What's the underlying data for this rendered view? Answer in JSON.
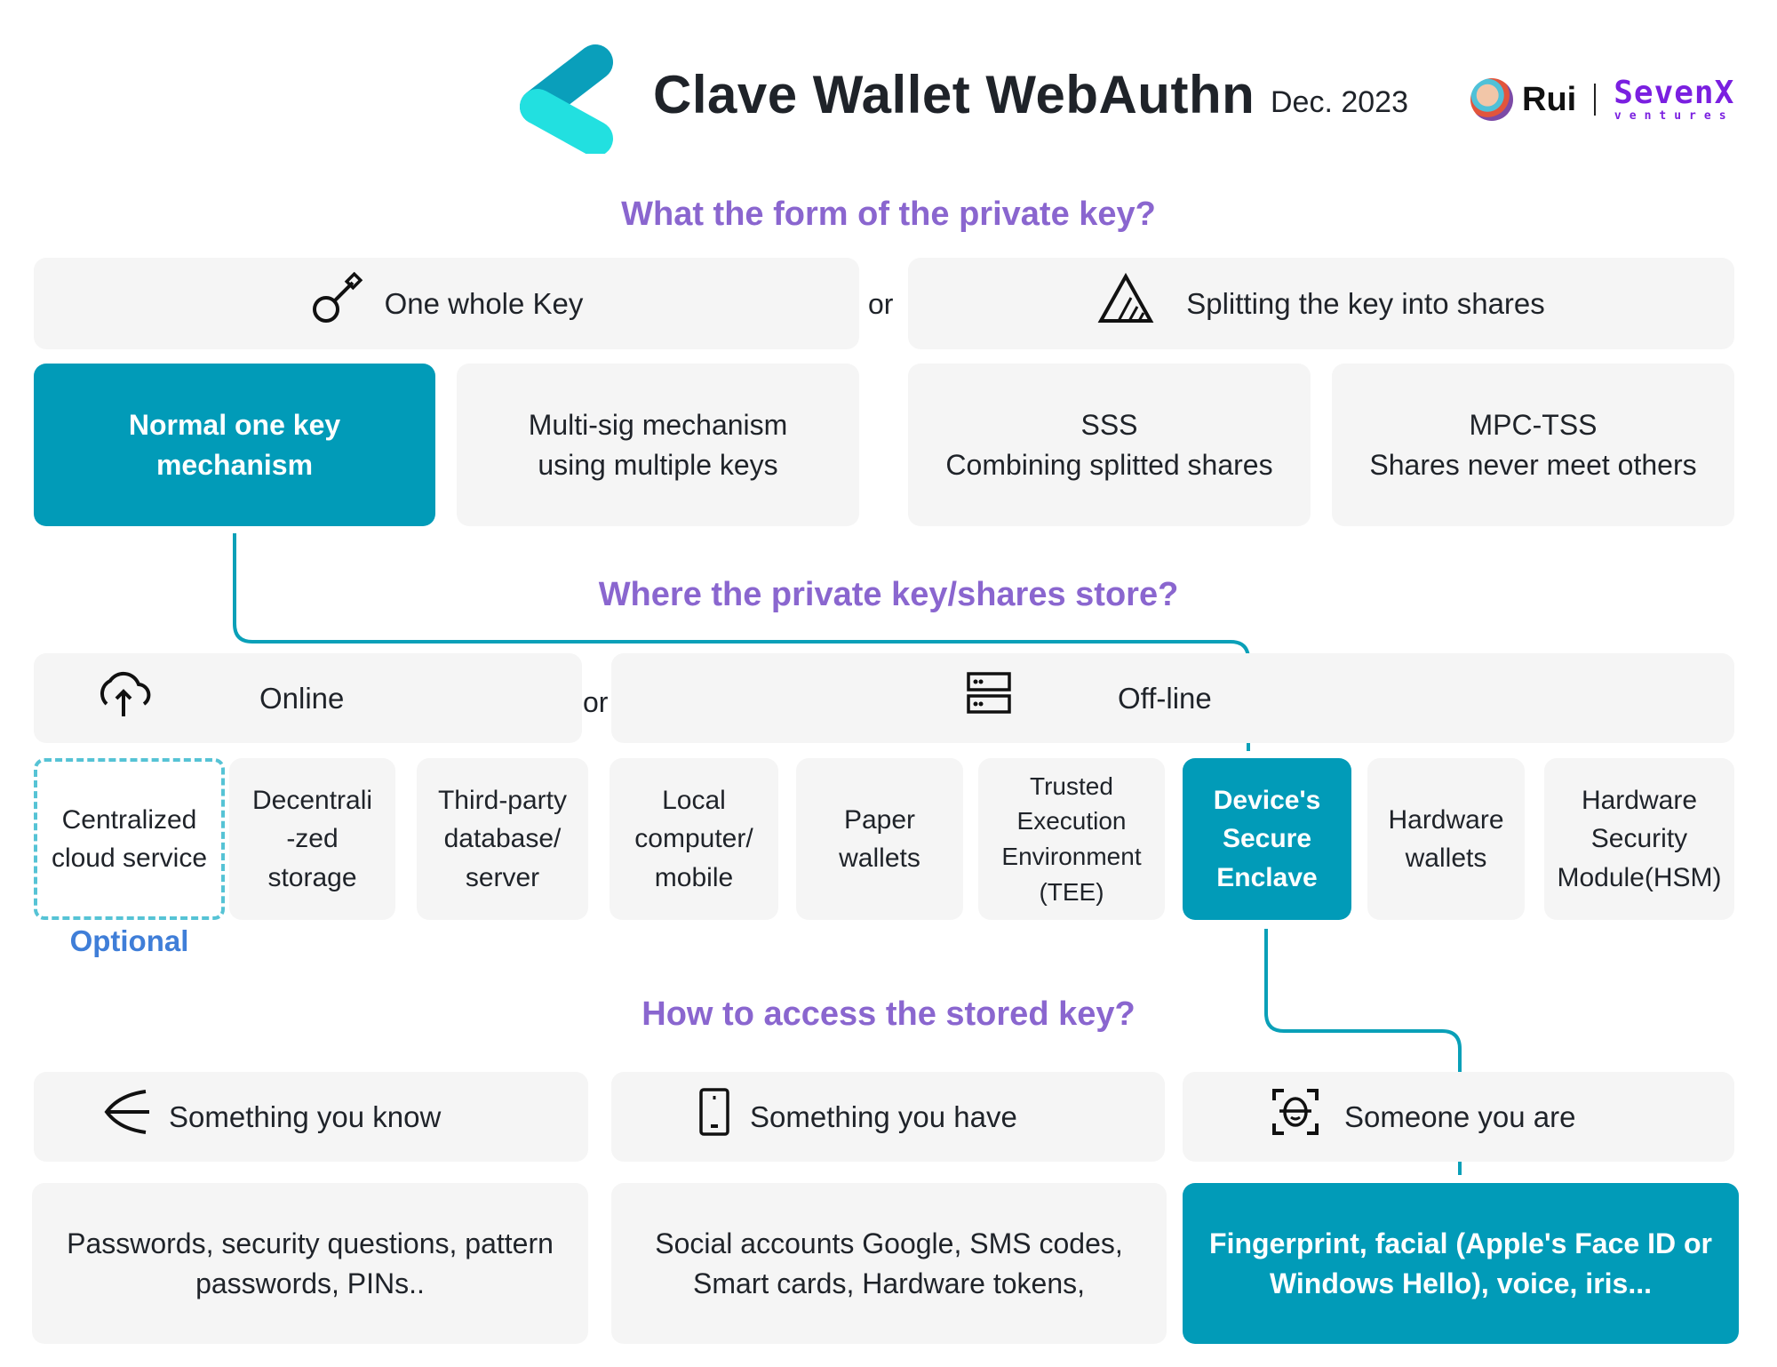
{
  "header": {
    "title": "Clave Wallet WebAuthn",
    "date": "Dec. 2023",
    "author": "Rui",
    "brand_main": "SevenX",
    "brand_sub": "ventures",
    "logo_colors": {
      "dark": "#0aa3bd",
      "light": "#1fe0e0"
    }
  },
  "colors": {
    "accent": "#019bb8",
    "heading": "#8a66cf",
    "optional": "#3f7ed8",
    "card_bg": "#f5f5f5",
    "dashed_border": "#56c3d5"
  },
  "sections": {
    "key_form": {
      "heading": "What the form of the private key?",
      "or_label": "or",
      "categories": [
        {
          "label": "One whole Key",
          "icon": "key-icon"
        },
        {
          "label": "Splitting the key into shares",
          "icon": "split-triangle-icon"
        }
      ],
      "options": [
        {
          "line1": "Normal one key",
          "line2": "mechanism",
          "selected": true
        },
        {
          "line1": "Multi-sig mechanism",
          "line2": "using multiple keys",
          "selected": false
        },
        {
          "line1": "SSS",
          "line2": "Combining splitted shares",
          "selected": false
        },
        {
          "line1": "MPC-TSS",
          "line2": "Shares never meet others",
          "selected": false
        }
      ]
    },
    "storage": {
      "heading": "Where the private key/shares store?",
      "or_label": "or",
      "categories": [
        {
          "label": "Online",
          "icon": "cloud-upload-icon"
        },
        {
          "label": "Off-line",
          "icon": "server-icon"
        }
      ],
      "options": [
        {
          "lines": [
            "Centralized",
            "cloud service"
          ],
          "selected": false,
          "optional": true
        },
        {
          "lines": [
            "Decentrali",
            "-zed",
            "storage"
          ],
          "selected": false
        },
        {
          "lines": [
            "Third-party",
            "database/",
            "server"
          ],
          "selected": false
        },
        {
          "lines": [
            "Local",
            "computer/",
            "mobile"
          ],
          "selected": false
        },
        {
          "lines": [
            "Paper",
            "wallets"
          ],
          "selected": false
        },
        {
          "lines": [
            "Trusted",
            "Execution",
            "Environment",
            "(TEE)"
          ],
          "selected": false
        },
        {
          "lines": [
            "Device's",
            "Secure",
            "Enclave"
          ],
          "selected": true
        },
        {
          "lines": [
            "Hardware",
            "wallets"
          ],
          "selected": false
        },
        {
          "lines": [
            "Hardware",
            "Security",
            "Module(HSM)"
          ],
          "selected": false
        }
      ],
      "optional_label": "Optional"
    },
    "access": {
      "heading": "How to access the stored key?",
      "categories": [
        {
          "label": "Something you know",
          "icon": "arrow-left-icon"
        },
        {
          "label": "Something you have",
          "icon": "phone-icon"
        },
        {
          "label": "Someone you are",
          "icon": "face-scan-icon"
        }
      ],
      "options": [
        {
          "line1": "Passwords, security questions, pattern",
          "line2": "passwords, PINs..",
          "selected": false
        },
        {
          "line1": "Social accounts Google, SMS codes,",
          "line2": "Smart cards, Hardware tokens,",
          "selected": false
        },
        {
          "line1": "Fingerprint, facial (Apple's Face ID or",
          "line2": "Windows Hello), voice, iris...",
          "selected": true
        }
      ]
    }
  }
}
